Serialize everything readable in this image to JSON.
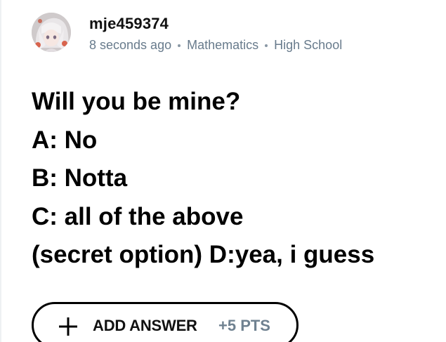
{
  "post": {
    "username": "mje459374",
    "time_ago": "8 seconds ago",
    "subject": "Mathematics",
    "level": "High School"
  },
  "question": {
    "lines": [
      "Will you be mine?",
      "A: No",
      "B: Notta",
      "C: all of the above",
      "(secret option) D:yea, i guess"
    ]
  },
  "answer_button": {
    "label": "ADD ANSWER",
    "points": "+5 PTS"
  },
  "colors": {
    "meta_text": "#687b8c",
    "points_text": "#6f8190",
    "button_border": "#000000"
  },
  "icons": {
    "avatar": "anime-avatar",
    "plus": "plus-icon"
  }
}
